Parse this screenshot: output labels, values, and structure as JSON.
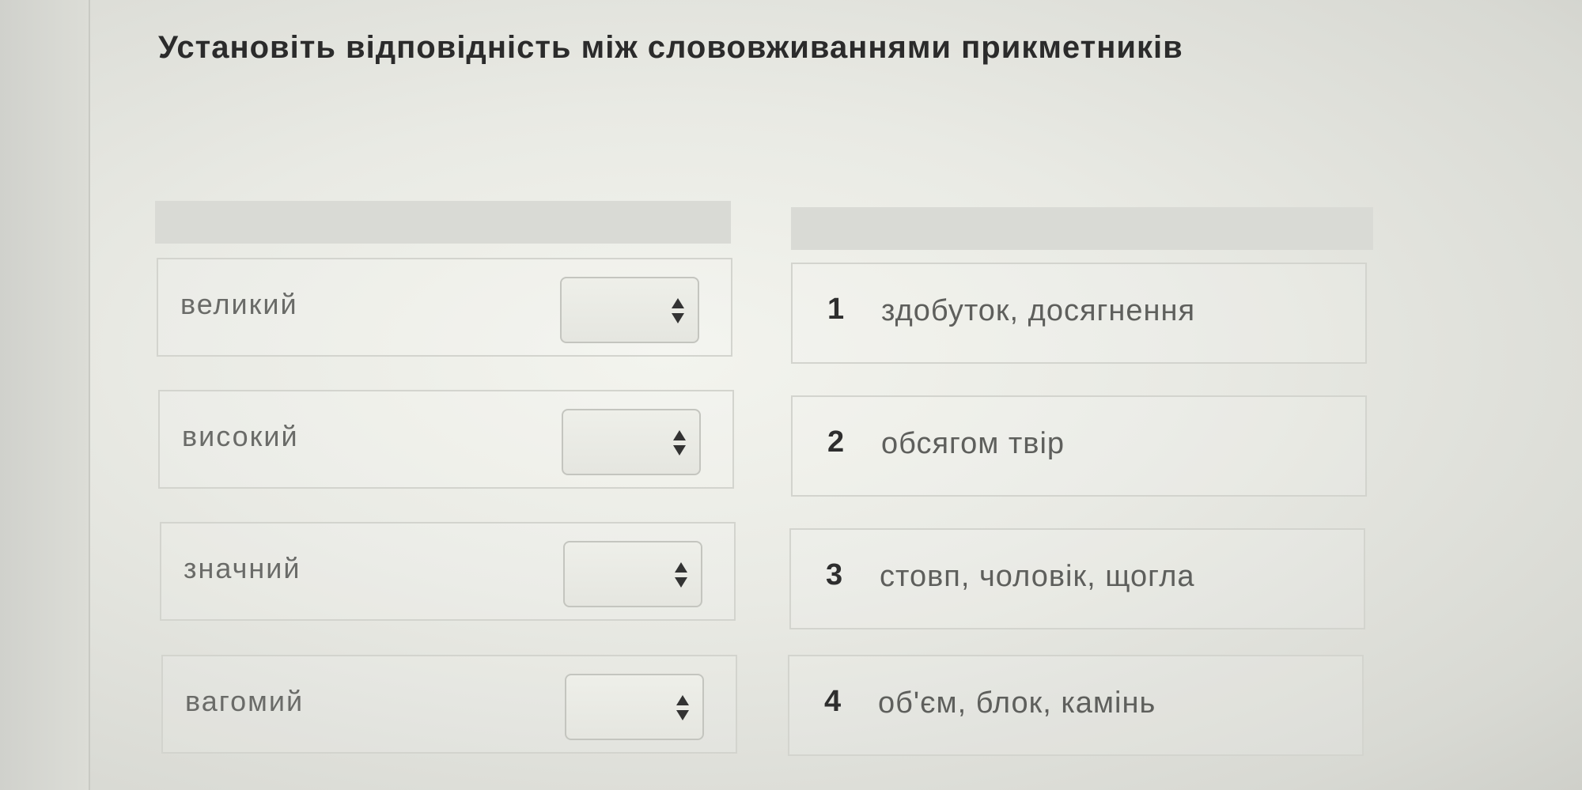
{
  "question": {
    "title": "Установіть відповідність між слововживаннями прикметників"
  },
  "left_items": [
    {
      "label": "великий",
      "selected": ""
    },
    {
      "label": "високий",
      "selected": ""
    },
    {
      "label": "значний",
      "selected": ""
    },
    {
      "label": "вагомий",
      "selected": ""
    }
  ],
  "right_items": [
    {
      "number": "1",
      "text": "здобуток, досягнення"
    },
    {
      "number": "2",
      "text": "обсягом твір"
    },
    {
      "number": "3",
      "text": "стовп, чоловік, щогла"
    },
    {
      "number": "4",
      "text": "об'єм, блок, камінь"
    }
  ],
  "icons": {
    "select_caret": "sort-arrows-icon"
  }
}
